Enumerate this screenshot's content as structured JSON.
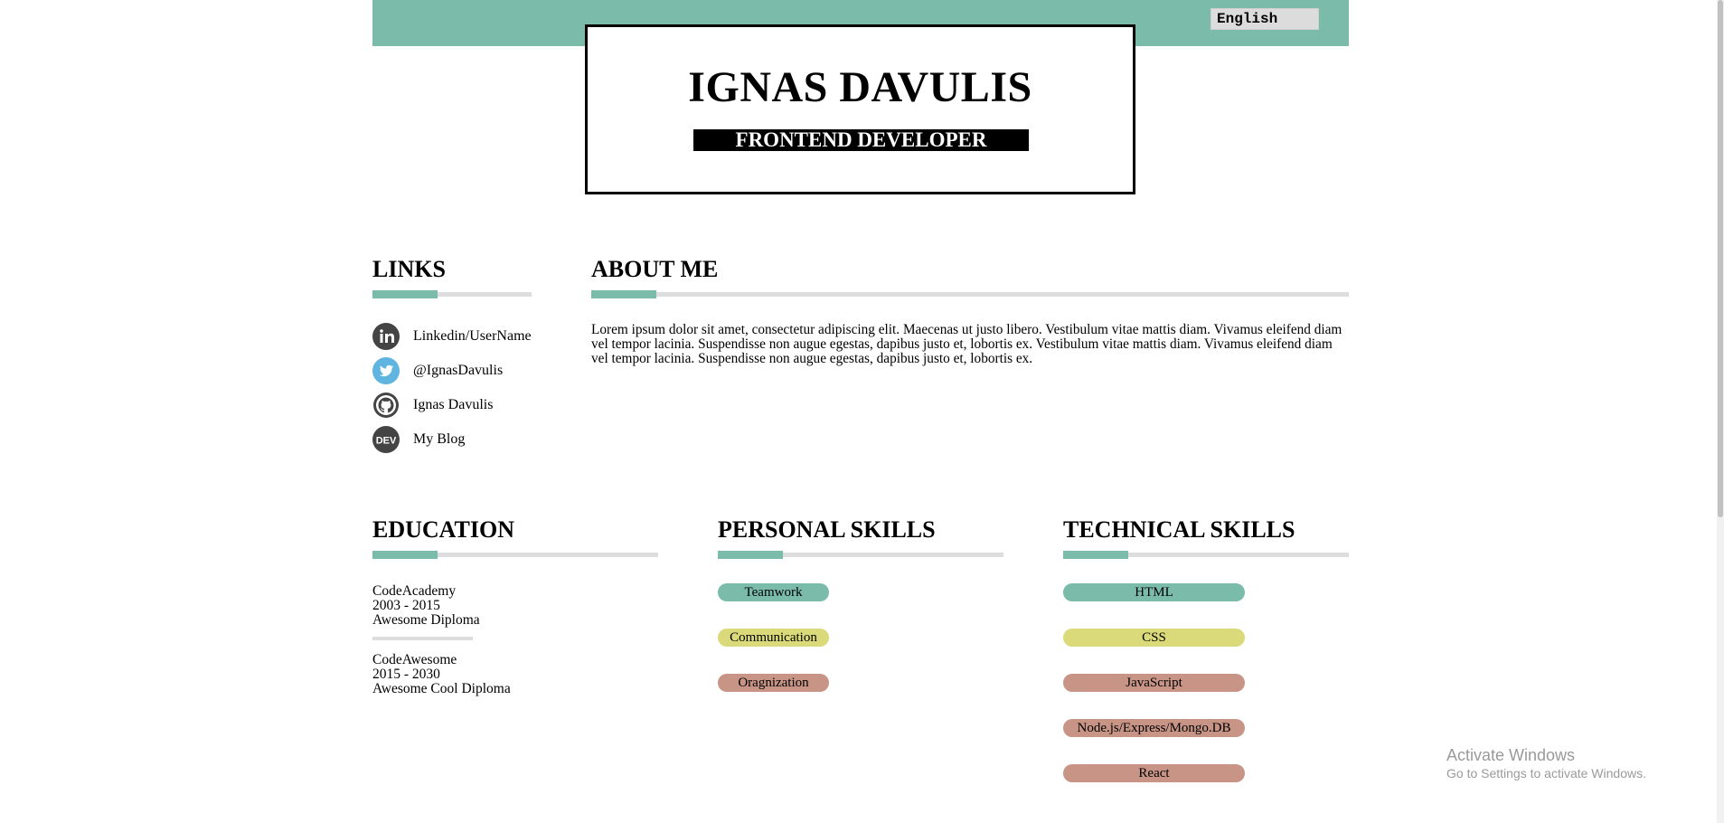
{
  "header": {
    "language": "English",
    "name": "IGNAS DAVULIS",
    "role": "FRONTEND DEVELOPER",
    "accent_color": "#7bbbaa"
  },
  "links": {
    "heading": "LINKS",
    "items": [
      {
        "label": "Linkedin/UserName",
        "icon": "linkedin-icon"
      },
      {
        "label": "@IgnasDavulis",
        "icon": "twitter-icon"
      },
      {
        "label": "Ignas Davulis",
        "icon": "github-icon"
      },
      {
        "label": "My Blog",
        "icon": "dev-icon"
      }
    ]
  },
  "about": {
    "heading": "ABOUT ME",
    "text": "Lorem ipsum dolor sit amet, consectetur adipiscing elit. Maecenas ut justo libero. Vestibulum vitae mattis diam. Vivamus eleifend diam vel tempor lacinia. Suspendisse non augue egestas, dapibus justo et, lobortis ex. Vestibulum vitae mattis diam. Vivamus eleifend diam vel tempor lacinia. Suspendisse non augue egestas, dapibus justo et, lobortis ex."
  },
  "education": {
    "heading": "EDUCATION",
    "entries": [
      {
        "school": "CodeAcademy",
        "years": "2003 - 2015",
        "diploma": "Awesome Diploma"
      },
      {
        "school": "CodeAwesome",
        "years": "2015 - 2030",
        "diploma": "Awesome Cool Diploma"
      }
    ]
  },
  "personal_skills": {
    "heading": "PERSONAL SKILLS",
    "items": [
      {
        "label": "Teamwork",
        "color": "#7bbbaa"
      },
      {
        "label": "Communication",
        "color": "#dada7a"
      },
      {
        "label": "Oragnization",
        "color": "#c79486"
      }
    ]
  },
  "technical_skills": {
    "heading": "TECHNICAL SKILLS",
    "items": [
      {
        "label": "HTML",
        "color": "#7bbbaa"
      },
      {
        "label": "CSS",
        "color": "#dada7a"
      },
      {
        "label": "JavaScript",
        "color": "#c79486"
      },
      {
        "label": "Node.js/Express/Mongo.DB",
        "color": "#c79486"
      },
      {
        "label": "React",
        "color": "#c79486"
      }
    ]
  },
  "watermark": {
    "title": "Activate Windows",
    "subtitle": "Go to Settings to activate Windows."
  }
}
